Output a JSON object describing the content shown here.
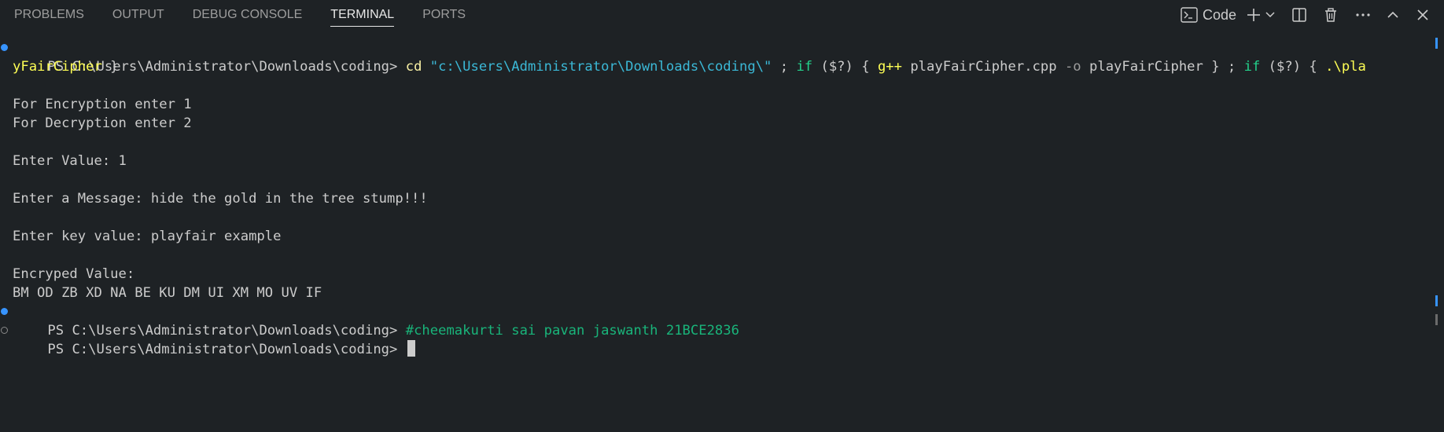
{
  "tabs": [
    "PROBLEMS",
    "OUTPUT",
    "DEBUG CONSOLE",
    "TERMINAL",
    "PORTS"
  ],
  "active_tab": "TERMINAL",
  "toolbar": {
    "shell_label": "Code",
    "icons": [
      "terminal-icon",
      "plus-icon",
      "chevron-down-icon",
      "split-icon",
      "trash-icon",
      "more-icon",
      "chevron-up-icon",
      "close-icon"
    ]
  },
  "terminal": {
    "prompt": "PS C:\\Users\\Administrator\\Downloads\\coding> ",
    "command": {
      "cd": "cd",
      "path": "\"c:\\Users\\Administrator\\Downloads\\coding\\\"",
      "sep1": " ; ",
      "if1": "if",
      "cond1": " ($?) { ",
      "gpp": "g++",
      "compile_args": " playFairCipher.cpp ",
      "flag": "-o",
      "out_name": " playFairCipher } ; ",
      "if2": "if",
      "cond2": " ($?) { ",
      "run_part1": ".\\pla",
      "run_part2": "yFairCipher",
      "close": " }"
    },
    "output": [
      "",
      "For Encryption enter 1",
      "For Decryption enter 2",
      "",
      "Enter Value: 1",
      "",
      "Enter a Message: hide the gold in the tree stump!!!",
      "",
      "Enter key value: playfair example",
      "",
      "Encryped Value:",
      "BM OD ZB XD NA BE KU DM UI XM MO UV IF"
    ],
    "comment": "#cheemakurti sai pavan jaswanth 21BCE2836"
  },
  "colors": {
    "background": "#1e2225",
    "command_yellow": "#f9f1a5",
    "string_blue": "#3bb8d6",
    "keyword_green": "#23d18b",
    "decoration_blue": "#3794ff"
  }
}
